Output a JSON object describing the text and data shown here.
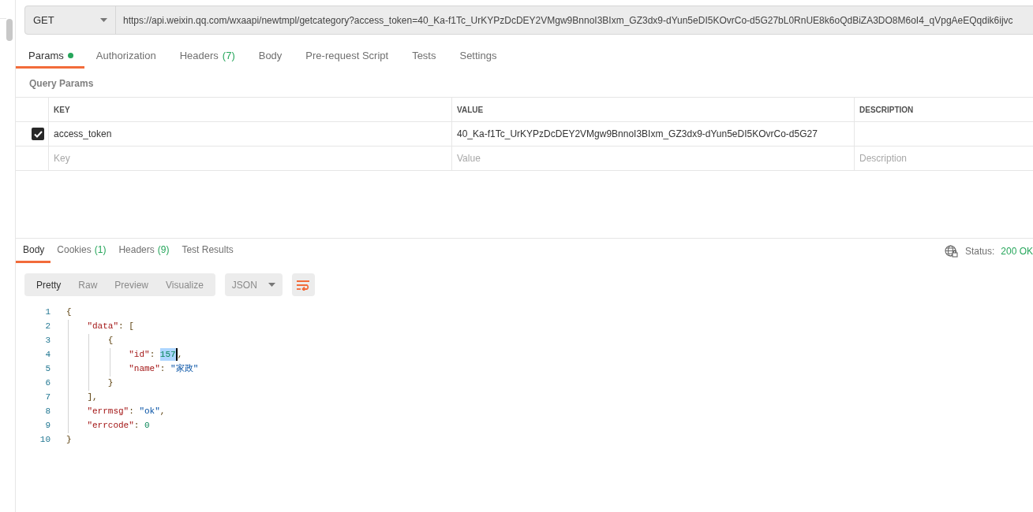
{
  "request": {
    "method": "GET",
    "url": "https://api.weixin.qq.com/wxaapi/newtmpl/getcategory?access_token=40_Ka-f1Tc_UrKYPzDcDEY2VMgw9BnnoI3BIxm_GZ3dx9-dYun5eDI5KOvrCo-d5G27bL0RnUE8k6oQdBiZA3DO8M6oI4_qVpgAeEQqdik6ijvc"
  },
  "request_tabs": [
    {
      "label": "Params",
      "dot": true,
      "selected": true
    },
    {
      "label": "Authorization",
      "dot": false,
      "selected": false
    },
    {
      "label": "Headers",
      "count": "(7)",
      "dot": false,
      "selected": false
    },
    {
      "label": "Body",
      "dot": false,
      "selected": false
    },
    {
      "label": "Pre-request Script",
      "dot": false,
      "selected": false
    },
    {
      "label": "Tests",
      "dot": false,
      "selected": false
    },
    {
      "label": "Settings",
      "dot": false,
      "selected": false
    }
  ],
  "query_params": {
    "title": "Query Params",
    "columns": [
      "KEY",
      "VALUE",
      "DESCRIPTION"
    ],
    "rows": [
      {
        "checked": true,
        "key": "access_token",
        "value": "40_Ka-f1Tc_UrKYPzDcDEY2VMgw9BnnoI3BIxm_GZ3dx9-dYun5eDI5KOvrCo-d5G27",
        "description": ""
      }
    ],
    "new_row": {
      "key": {
        "placeholder": "Key"
      },
      "value": {
        "placeholder": "Value"
      },
      "description": {
        "placeholder": "Description"
      }
    }
  },
  "response_tabs": [
    {
      "label": "Body",
      "selected": true
    },
    {
      "label": "Cookies",
      "count": "(1)",
      "selected": false
    },
    {
      "label": "Headers",
      "count": "(9)",
      "selected": false
    },
    {
      "label": "Test Results",
      "selected": false
    }
  ],
  "status": {
    "label": "Status:",
    "value": "200 OK"
  },
  "view_modes": [
    {
      "label": "Pretty",
      "selected": true
    },
    {
      "label": "Raw",
      "selected": false
    },
    {
      "label": "Preview",
      "selected": false
    },
    {
      "label": "Visualize",
      "selected": false
    }
  ],
  "format": "JSON",
  "code": [
    {
      "number": "1",
      "tokens": [
        {
          "kind": "punct",
          "text": "{",
          "selected": false
        }
      ]
    },
    {
      "number": "2",
      "tokens": [
        {
          "kind": "key",
          "text": "    \"data\"",
          "selected": false
        },
        {
          "kind": "punct",
          "text": ": [",
          "selected": false
        }
      ]
    },
    {
      "number": "3",
      "tokens": [
        {
          "kind": "punct",
          "text": "        {",
          "selected": false
        }
      ]
    },
    {
      "number": "4",
      "tokens": [
        {
          "kind": "key",
          "text": "            \"id\"",
          "selected": false
        },
        {
          "kind": "punct",
          "text": ": ",
          "selected": false
        },
        {
          "kind": "number",
          "text": "157",
          "selected": true
        },
        {
          "kind": "punct",
          "text": ",",
          "selected": false
        }
      ]
    },
    {
      "number": "5",
      "tokens": [
        {
          "kind": "key",
          "text": "            \"name\"",
          "selected": false
        },
        {
          "kind": "punct",
          "text": ": ",
          "selected": false
        },
        {
          "kind": "string",
          "text": "\"家政\"",
          "selected": false
        }
      ]
    },
    {
      "number": "6",
      "tokens": [
        {
          "kind": "punct",
          "text": "        }",
          "selected": false
        }
      ]
    },
    {
      "number": "7",
      "tokens": [
        {
          "kind": "punct",
          "text": "    ],",
          "selected": false
        }
      ]
    },
    {
      "number": "8",
      "tokens": [
        {
          "kind": "key",
          "text": "    \"errmsg\"",
          "selected": false
        },
        {
          "kind": "punct",
          "text": ": ",
          "selected": false
        },
        {
          "kind": "string",
          "text": "\"ok\"",
          "selected": false
        },
        {
          "kind": "punct",
          "text": ",",
          "selected": false
        }
      ]
    },
    {
      "number": "9",
      "tokens": [
        {
          "kind": "key",
          "text": "    \"errcode\"",
          "selected": false
        },
        {
          "kind": "punct",
          "text": ": ",
          "selected": false
        },
        {
          "kind": "number",
          "text": "0",
          "selected": false
        }
      ]
    },
    {
      "number": "10",
      "tokens": [
        {
          "kind": "punct",
          "text": "}",
          "selected": false
        }
      ]
    }
  ]
}
